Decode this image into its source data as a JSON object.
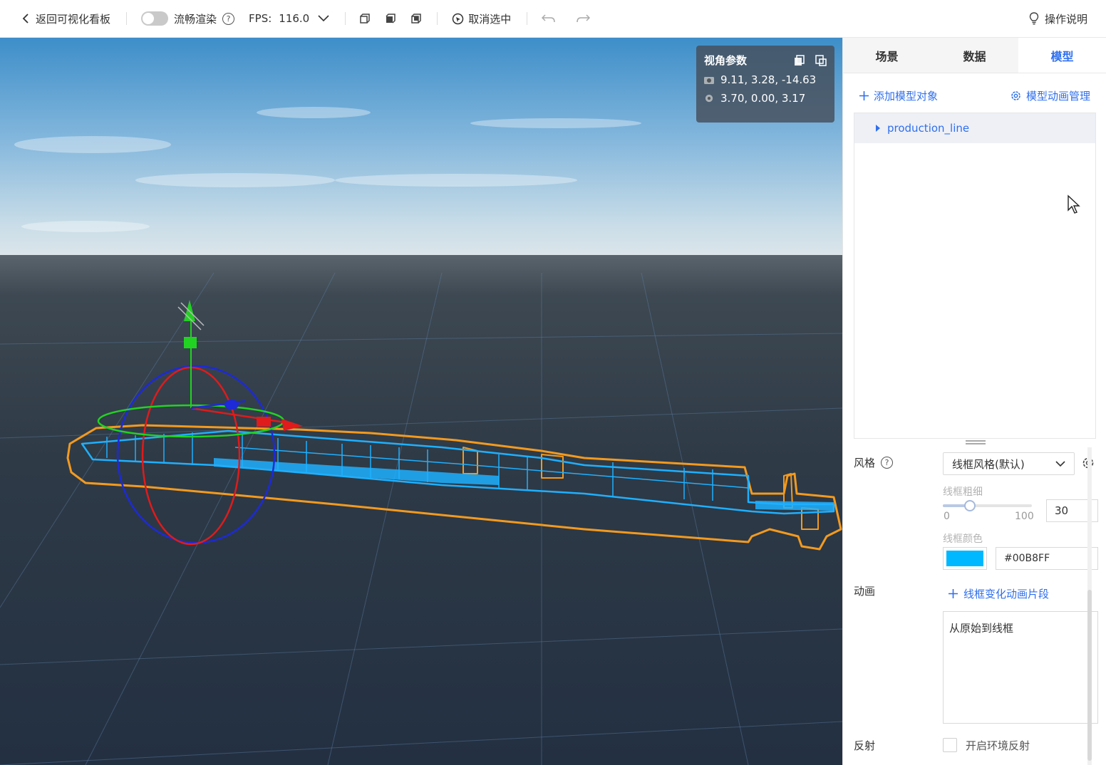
{
  "toolbar": {
    "back_label": "返回可视化看板",
    "smooth_label": "流畅渲染",
    "fps_label": "FPS:",
    "fps_value": "116.0",
    "deselect_label": "取消选中",
    "help_label": "操作说明"
  },
  "camera_panel": {
    "title": "视角参数",
    "position": "9.11, 3.28, -14.63",
    "target": "3.70, 0.00, 3.17"
  },
  "sidebar": {
    "tabs": [
      {
        "label": "场景",
        "active": false
      },
      {
        "label": "数据",
        "active": false
      },
      {
        "label": "模型",
        "active": true
      }
    ],
    "add_model_label": "添加模型对象",
    "anim_manage_label": "模型动画管理",
    "tree": [
      {
        "label": "production_line",
        "expanded": false
      }
    ],
    "style": {
      "label": "风格",
      "selected": "线框风格(默认)",
      "wire_width_label": "线框粗细",
      "slider_min": "0",
      "slider_max": "100",
      "slider_value": "30",
      "wire_color_label": "线框颜色",
      "wire_color": "#00B8FF",
      "wire_color_text": "#00B8FF"
    },
    "animation": {
      "label": "动画",
      "add_clip_label": "线框变化动画片段",
      "clips": [
        "从原始到线框"
      ]
    },
    "reflection": {
      "label": "反射",
      "checkbox_label": "开启环境反射",
      "checked": false
    }
  },
  "colors": {
    "accent": "#2f6fed",
    "wireframe_blue": "#1fb0ff",
    "wireframe_orange": "#f39a1f"
  }
}
